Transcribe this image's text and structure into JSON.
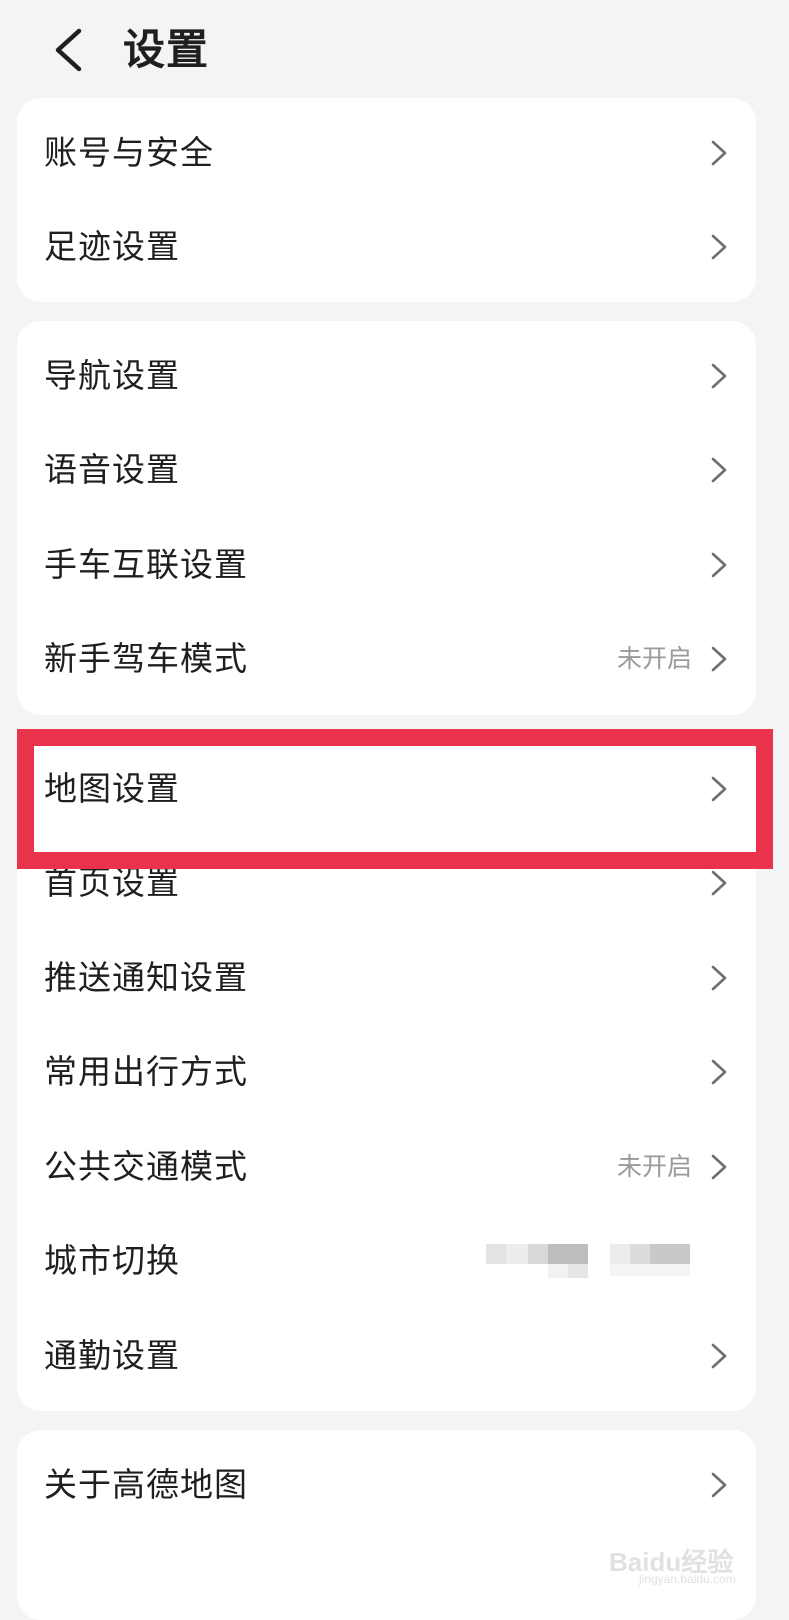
{
  "header": {
    "title": "设置",
    "back_icon": "chevron-left-icon"
  },
  "groups": [
    {
      "items": [
        {
          "label": "账号与安全"
        },
        {
          "label": "足迹设置"
        }
      ]
    },
    {
      "items": [
        {
          "label": "导航设置"
        },
        {
          "label": "语音设置"
        },
        {
          "label": "手车互联设置"
        },
        {
          "label": "新手驾车模式",
          "status": "未开启"
        }
      ]
    },
    {
      "items": [
        {
          "label": "地图设置",
          "highlighted": true
        },
        {
          "label": "首页设置"
        },
        {
          "label": "推送通知设置"
        },
        {
          "label": "常用出行方式"
        },
        {
          "label": "公共交通模式",
          "status": "未开启"
        },
        {
          "label": "城市切换",
          "value_redacted": true
        },
        {
          "label": "通勤设置"
        }
      ]
    },
    {
      "items": [
        {
          "label": "关于高德地图"
        }
      ]
    }
  ],
  "colors": {
    "background": "#f3f4f6",
    "card": "#ffffff",
    "highlight": "#e8334b",
    "status_text": "#9a9a9a"
  },
  "watermark": {
    "brand": "Baidu经验",
    "url": "jingyan.baidu.com"
  }
}
